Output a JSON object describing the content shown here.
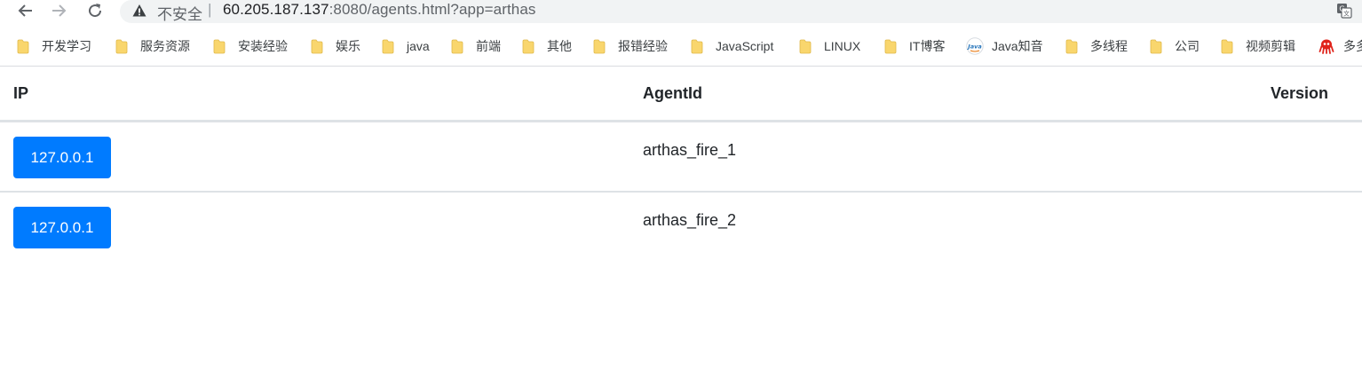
{
  "browser": {
    "security_label": "不安全",
    "url_host": "60.205.187.137",
    "url_rest": ":8080/agents.html?app=arthas",
    "icons": {
      "back": "back-arrow-icon",
      "forward": "forward-arrow-icon",
      "reload": "reload-icon",
      "warning": "warning-triangle-icon",
      "translate": "google-translate-icon"
    }
  },
  "bookmarks": [
    {
      "label": "开发学习",
      "icon": "folder-icon"
    },
    {
      "label": "服务资源",
      "icon": "folder-icon"
    },
    {
      "label": "安装经验",
      "icon": "folder-icon"
    },
    {
      "label": "娱乐",
      "icon": "folder-icon"
    },
    {
      "label": "java",
      "icon": "folder-icon"
    },
    {
      "label": "前端",
      "icon": "folder-icon"
    },
    {
      "label": "其他",
      "icon": "folder-icon"
    },
    {
      "label": "报错经验",
      "icon": "folder-icon"
    },
    {
      "label": "JavaScript",
      "icon": "folder-icon"
    },
    {
      "label": "LINUX",
      "icon": "folder-icon"
    },
    {
      "label": "IT博客",
      "icon": "folder-icon"
    },
    {
      "label": "Java知音",
      "icon": "java-logo-icon",
      "logo_text": "Java"
    },
    {
      "label": "多线程",
      "icon": "folder-icon"
    },
    {
      "label": "公司",
      "icon": "folder-icon"
    },
    {
      "label": "视频剪辑",
      "icon": "folder-icon"
    },
    {
      "label": "多多",
      "icon": "octopus-icon"
    }
  ],
  "table": {
    "headers": {
      "ip": "IP",
      "agent_id": "AgentId",
      "version": "Version"
    },
    "rows": [
      {
        "ip": "127.0.0.1",
        "agent_id": "arthas_fire_1",
        "version": ""
      },
      {
        "ip": "127.0.0.1",
        "agent_id": "arthas_fire_2",
        "version": ""
      }
    ]
  },
  "colors": {
    "primary_button": "#007bff",
    "folder": "#f9d66d",
    "table_border": "#dee2e6",
    "omnibox_bg": "#f1f3f4"
  }
}
